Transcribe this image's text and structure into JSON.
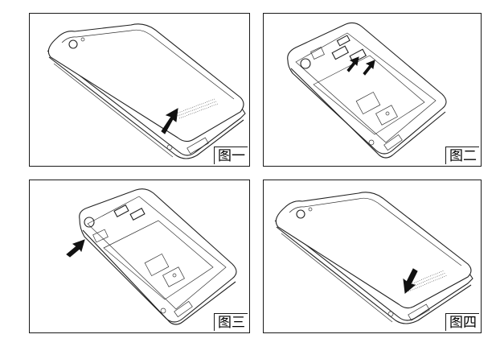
{
  "figures": [
    {
      "caption": "图一",
      "back_cover": "on",
      "arrow": "lift-up"
    },
    {
      "caption": "图二",
      "back_cover": "off",
      "arrow": "insert-cards"
    },
    {
      "caption": "图三",
      "back_cover": "off",
      "arrow": "battery-connector"
    },
    {
      "caption": "图四",
      "back_cover": "on",
      "arrow": "press-down"
    }
  ],
  "colors": {
    "line": "#222222",
    "frame": "#1a1a1a",
    "background": "#ffffff"
  }
}
